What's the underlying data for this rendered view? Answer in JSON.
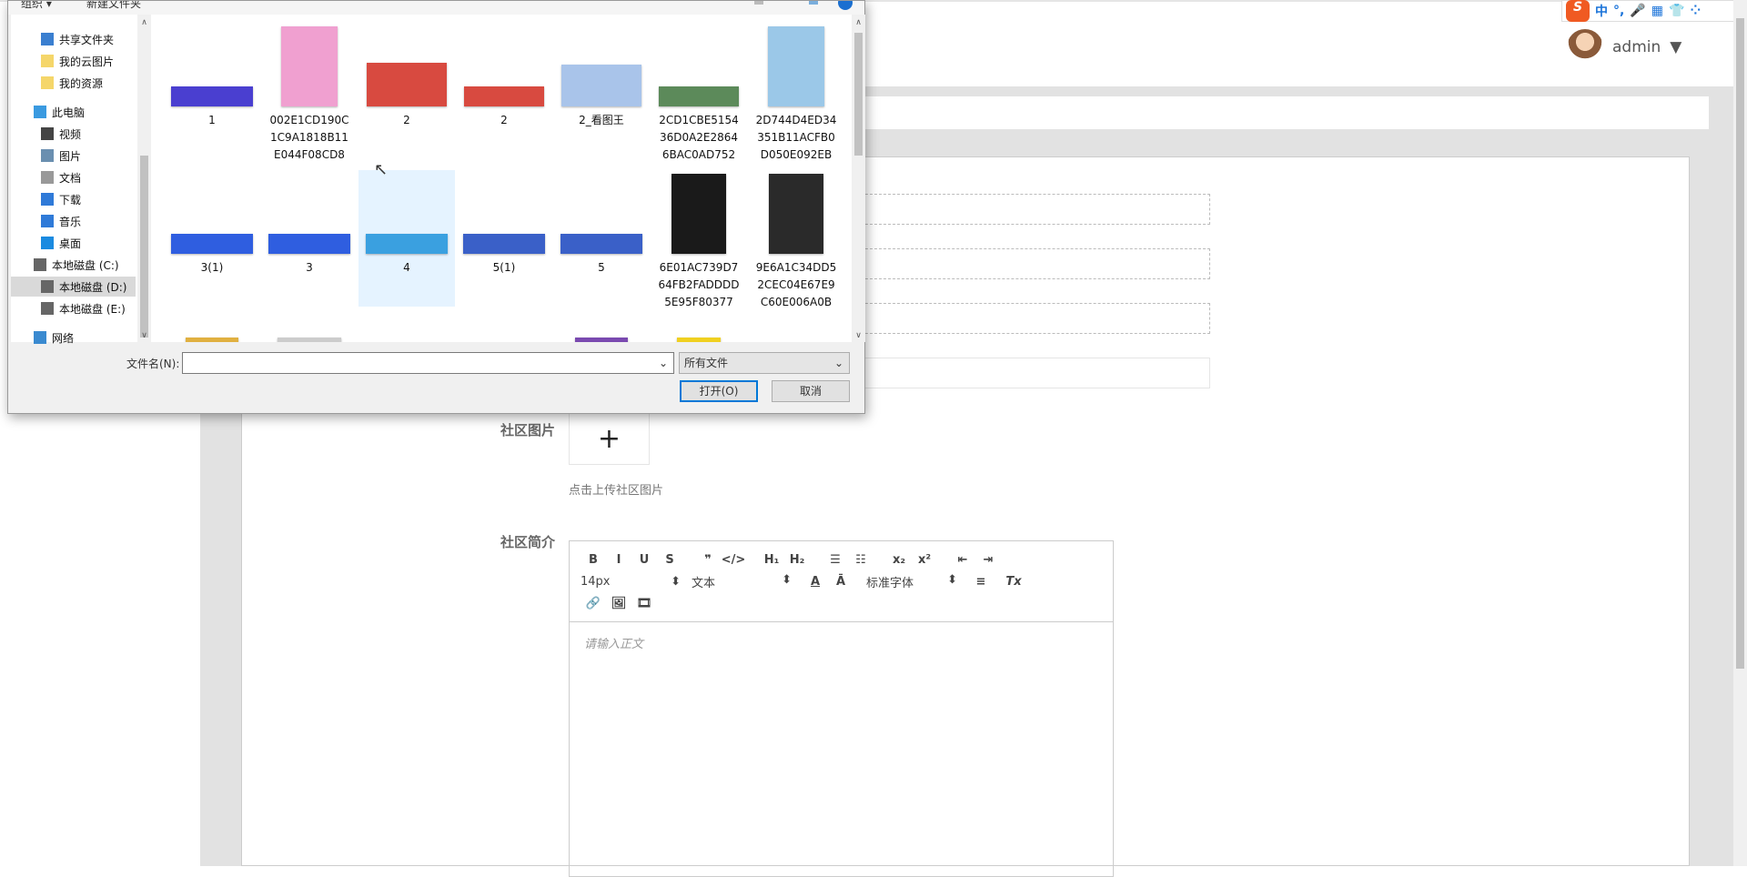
{
  "header": {
    "user": "admin"
  },
  "ime": {
    "items": [
      "中",
      "°,",
      "🎤",
      "▦",
      "👕",
      "⁘"
    ]
  },
  "form": {
    "image_label": "社区图片",
    "upload_hint": "点击上传社区图片",
    "intro_label": "社区简介",
    "editor": {
      "row1": [
        "B",
        "I",
        "U",
        "S",
        "❞",
        "</>",
        "H₁",
        "H₂",
        "☰",
        "☷",
        "x₂",
        "x²",
        "⇤",
        "⇥"
      ],
      "font_size": "14px",
      "block": "文本",
      "font_family": "标准字体",
      "row2_icons": [
        "A",
        "Ā",
        "≡",
        "Tx"
      ],
      "row3": [
        "🔗",
        "🖼",
        "🎞"
      ],
      "placeholder": "请输入正文"
    }
  },
  "dialog": {
    "toolbar": {
      "organize": "组织 ▾",
      "new_folder": "新建文件夹"
    },
    "nav": [
      {
        "label": "共享文件夹",
        "icon": "shared-folder-icon"
      },
      {
        "label": "我的云图片",
        "icon": "folder-icon"
      },
      {
        "label": "我的资源",
        "icon": "folder-icon"
      },
      {
        "label": "此电脑",
        "icon": "computer-icon"
      },
      {
        "label": "视频",
        "icon": "video-icon"
      },
      {
        "label": "图片",
        "icon": "pictures-icon"
      },
      {
        "label": "文档",
        "icon": "documents-icon"
      },
      {
        "label": "下载",
        "icon": "download-icon"
      },
      {
        "label": "音乐",
        "icon": "music-icon"
      },
      {
        "label": "桌面",
        "icon": "desktop-icon"
      },
      {
        "label": "本地磁盘 (C:)",
        "icon": "drive-icon"
      },
      {
        "label": "本地磁盘 (D:)",
        "icon": "drive-icon",
        "selected": true
      },
      {
        "label": "本地磁盘 (E:)",
        "icon": "drive-icon"
      },
      {
        "label": "网络",
        "icon": "network-icon"
      }
    ],
    "files": [
      {
        "name": "1",
        "color": "#4a3fd0"
      },
      {
        "name": "002E1CD190C1C9A1818B11E044F08CD8",
        "color": "#f0a0d0"
      },
      {
        "name": "2",
        "color": "#d84a40"
      },
      {
        "name": "2",
        "color": "#d84a40"
      },
      {
        "name": "2_看图王",
        "color": "#a9c4ea"
      },
      {
        "name": "2CD1CBE515436D0A2E28646BAC0AD752",
        "color": "#5c8a5a"
      },
      {
        "name": "2D744D4ED34351B11ACFB0D050E092EB",
        "color": "#9bc8e8"
      },
      {
        "name": "3(1)",
        "color": "#2f5ee0"
      },
      {
        "name": "3",
        "color": "#2f5ee0"
      },
      {
        "name": "4",
        "color": "#3aa0e0",
        "selected": true
      },
      {
        "name": "5(1)",
        "color": "#3a60c8"
      },
      {
        "name": "5",
        "color": "#3a60c8"
      },
      {
        "name": "6E01AC739D764FB2FADDDD5E95F80377",
        "color": "#1a1a1a"
      },
      {
        "name": "9E6A1C34DD52CEC04E67E9C60E006A0B",
        "color": "#2a2a2a"
      },
      {
        "name": "",
        "color": "#e0b040"
      },
      {
        "name": "",
        "color": "#ccc"
      },
      {
        "name": "",
        "color": "#fff"
      },
      {
        "name": "",
        "color": "#fff"
      },
      {
        "name": "",
        "color": "#7a4ab0"
      },
      {
        "name": "",
        "color": "#f0d020"
      }
    ],
    "filename_label": "文件名(N):",
    "filename_value": "",
    "filter": "所有文件",
    "open": "打开(O)",
    "cancel": "取消"
  }
}
